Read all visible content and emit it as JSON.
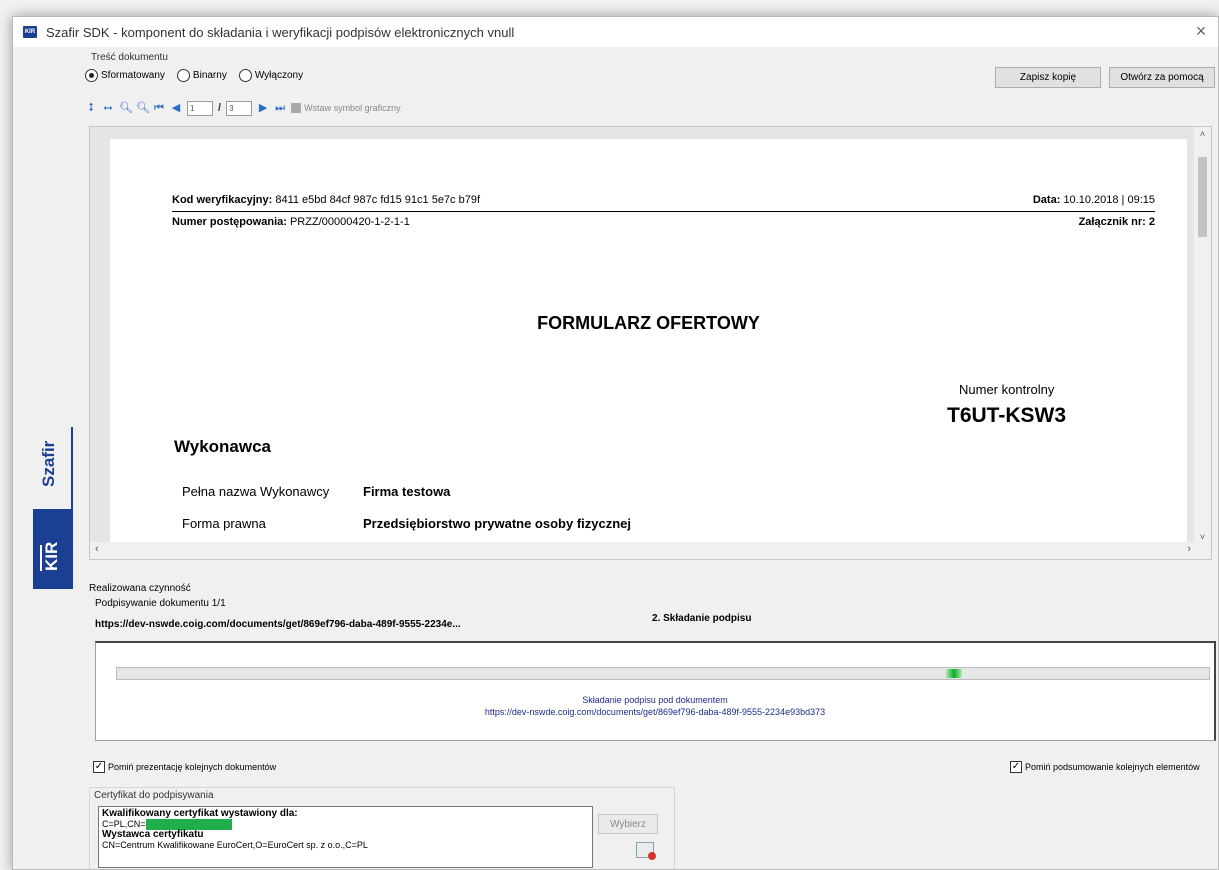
{
  "window": {
    "icon_text": "KIR",
    "title": "Szafir SDK - komponent do składania i weryfikacji podpisów elektronicznych vnull",
    "close_glyph": "×"
  },
  "brand": {
    "szafir": "Szafir",
    "kir": "KIR"
  },
  "content_group": {
    "label": "Treść dokumentu",
    "modes": [
      {
        "label": "Sformatowany",
        "selected": true
      },
      {
        "label": "Binarny",
        "selected": false
      },
      {
        "label": "Wyłączony",
        "selected": false
      }
    ],
    "save_copy": "Zapisz kopię",
    "open_with": "Otwórz za pomocą"
  },
  "toolbar": {
    "page_current": "1",
    "page_separator": "/",
    "page_total": "3",
    "insert_symbol": "Wstaw symbol graficzny",
    "icons": [
      "fit-height-icon",
      "fit-width-icon",
      "zoom-out-icon",
      "zoom-in-icon",
      "first-page-icon",
      "prev-page-icon",
      "next-page-icon",
      "last-page-icon"
    ]
  },
  "document": {
    "verification_label": "Kod weryfikacyjny:",
    "verification_code": "8411 e5bd 84cf 987c fd15 91c1 5e7c b79f",
    "date_label": "Data:",
    "date_value": "10.10.2018 | 09:15",
    "case_label": "Numer postępowania:",
    "case_value": "PRZZ/00000420-1-2-1-1",
    "attachment": "Załącznik nr: 2",
    "title": "FORMULARZ OFERTOWY",
    "control_label": "Numer kontrolny",
    "control_code": "T6UT-KSW3",
    "section": "Wykonawca",
    "fields": [
      {
        "label": "Pełna nazwa Wykonawcy",
        "value": "Firma testowa"
      },
      {
        "label": "Forma prawna",
        "value": "Przedsiębiorstwo prywatne osoby fizycznej"
      }
    ]
  },
  "activity": {
    "label": "Realizowana czynność",
    "signing": "Podpisywanie dokumentu 1/1",
    "url_short": "https://dev-nswde.coig.com/documents/get/869ef796-daba-489f-9555-2234e...",
    "step": "2. Składanie podpisu",
    "progress_percent": 77,
    "progress_caption": "Składanie podpisu pod dokumentem",
    "progress_url": "https://dev-nswde.coig.com/documents/get/869ef796-daba-489f-9555-2234e93bd373"
  },
  "options": {
    "skip_presentation": "Pomiń prezentację kolejnych dokumentów",
    "skip_summary": "Pomiń podsumowanie kolejnych elementów"
  },
  "certificate": {
    "label": "Certyfikat do podpisywania",
    "issued_for": "Kwalifikowany certyfikat wystawiony dla:",
    "subject": "C=PL,CN=",
    "issuer_heading": "Wystawca certyfikatu",
    "issuer": "CN=Centrum Kwalifikowane EuroCert,O=EuroCert sp. z o.o.,C=PL",
    "choose": "Wybierz"
  }
}
